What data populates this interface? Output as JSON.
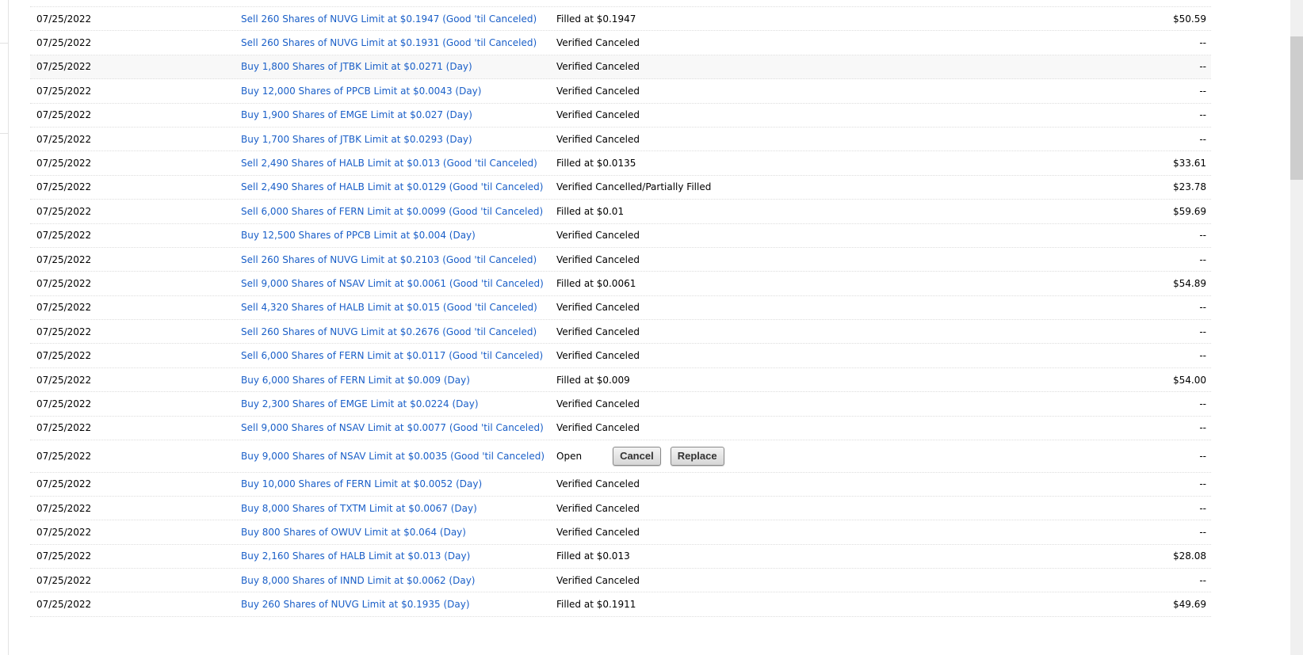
{
  "orders": [
    {
      "date": "07/25/2022",
      "order": "Sell 260 Shares of NUVG Limit at $0.1947 (Good 'til Canceled)",
      "status": "Filled at $0.1947",
      "amount": "$50.59"
    },
    {
      "date": "07/25/2022",
      "order": "Sell 260 Shares of NUVG Limit at $0.1931 (Good 'til Canceled)",
      "status": "Verified Canceled",
      "amount": "--"
    },
    {
      "date": "07/25/2022",
      "order": "Buy 1,800 Shares of JTBK Limit at $0.0271 (Day)",
      "status": "Verified Canceled",
      "amount": "--"
    },
    {
      "date": "07/25/2022",
      "order": "Buy 12,000 Shares of PPCB Limit at $0.0043 (Day)",
      "status": "Verified Canceled",
      "amount": "--"
    },
    {
      "date": "07/25/2022",
      "order": "Buy 1,900 Shares of EMGE Limit at $0.027 (Day)",
      "status": "Verified Canceled",
      "amount": "--"
    },
    {
      "date": "07/25/2022",
      "order": "Buy 1,700 Shares of JTBK Limit at $0.0293 (Day)",
      "status": "Verified Canceled",
      "amount": "--"
    },
    {
      "date": "07/25/2022",
      "order": "Sell 2,490 Shares of HALB Limit at $0.013 (Good 'til Canceled)",
      "status": "Filled at $0.0135",
      "amount": "$33.61"
    },
    {
      "date": "07/25/2022",
      "order": "Sell 2,490 Shares of HALB Limit at $0.0129 (Good 'til Canceled)",
      "status": "Verified Cancelled/Partially Filled",
      "amount": "$23.78"
    },
    {
      "date": "07/25/2022",
      "order": "Sell 6,000 Shares of FERN Limit at $0.0099 (Good 'til Canceled)",
      "status": "Filled at $0.01",
      "amount": "$59.69"
    },
    {
      "date": "07/25/2022",
      "order": "Buy 12,500 Shares of PPCB Limit at $0.004 (Day)",
      "status": "Verified Canceled",
      "amount": "--"
    },
    {
      "date": "07/25/2022",
      "order": "Sell 260 Shares of NUVG Limit at $0.2103 (Good 'til Canceled)",
      "status": "Verified Canceled",
      "amount": "--"
    },
    {
      "date": "07/25/2022",
      "order": "Sell 9,000 Shares of NSAV Limit at $0.0061 (Good 'til Canceled)",
      "status": "Filled at $0.0061",
      "amount": "$54.89"
    },
    {
      "date": "07/25/2022",
      "order": "Sell 4,320 Shares of HALB Limit at $0.015 (Good 'til Canceled)",
      "status": "Verified Canceled",
      "amount": "--"
    },
    {
      "date": "07/25/2022",
      "order": "Sell 260 Shares of NUVG Limit at $0.2676 (Good 'til Canceled)",
      "status": "Verified Canceled",
      "amount": "--"
    },
    {
      "date": "07/25/2022",
      "order": "Sell 6,000 Shares of FERN Limit at $0.0117 (Good 'til Canceled)",
      "status": "Verified Canceled",
      "amount": "--"
    },
    {
      "date": "07/25/2022",
      "order": "Buy 6,000 Shares of FERN Limit at $0.009 (Day)",
      "status": "Filled at $0.009",
      "amount": "$54.00"
    },
    {
      "date": "07/25/2022",
      "order": "Buy 2,300 Shares of EMGE Limit at $0.0224 (Day)",
      "status": "Verified Canceled",
      "amount": "--"
    },
    {
      "date": "07/25/2022",
      "order": "Sell 9,000 Shares of NSAV Limit at $0.0077 (Good 'til Canceled)",
      "status": "Verified Canceled",
      "amount": "--"
    },
    {
      "date": "07/25/2022",
      "order": "Buy 9,000 Shares of NSAV Limit at $0.0035 (Good 'til Canceled)",
      "status": "Open",
      "amount": "--",
      "cancel_label": "Cancel",
      "replace_label": "Replace"
    },
    {
      "date": "07/25/2022",
      "order": "Buy 10,000 Shares of FERN Limit at $0.0052 (Day)",
      "status": "Verified Canceled",
      "amount": "--"
    },
    {
      "date": "07/25/2022",
      "order": "Buy 8,000 Shares of TXTM Limit at $0.0067 (Day)",
      "status": "Verified Canceled",
      "amount": "--"
    },
    {
      "date": "07/25/2022",
      "order": "Buy 800 Shares of OWUV Limit at $0.064 (Day)",
      "status": "Verified Canceled",
      "amount": "--"
    },
    {
      "date": "07/25/2022",
      "order": "Buy 2,160 Shares of HALB Limit at $0.013 (Day)",
      "status": "Filled at $0.013",
      "amount": "$28.08"
    },
    {
      "date": "07/25/2022",
      "order": "Buy 8,000 Shares of INND Limit at $0.0062 (Day)",
      "status": "Verified Canceled",
      "amount": "--"
    },
    {
      "date": "07/25/2022",
      "order": "Buy 260 Shares of NUVG Limit at $0.1935 (Day)",
      "status": "Filled at $0.1911",
      "amount": "$49.69"
    }
  ],
  "highlight_row": 2
}
